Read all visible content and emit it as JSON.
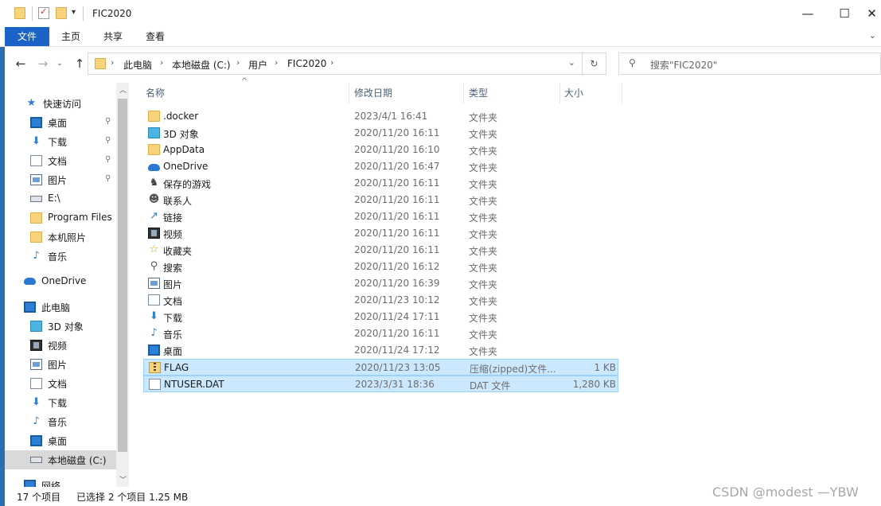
{
  "window": {
    "title": "FIC2020",
    "minimize": "—",
    "maximize": "☐",
    "close": "✕"
  },
  "ribbon": {
    "tabs": [
      "文件",
      "主页",
      "共享",
      "查看"
    ],
    "active_color": "#1c63c7"
  },
  "address": {
    "crumbs": [
      "此电脑",
      "本地磁盘 (C:)",
      "用户",
      "FIC2020"
    ],
    "search_placeholder": "搜索\"FIC2020\""
  },
  "nav": {
    "items": [
      {
        "label": "快速访问",
        "icon": "star-icon",
        "pinned": false
      },
      {
        "label": "桌面",
        "icon": "desktop-icon",
        "pinned": true
      },
      {
        "label": "下载",
        "icon": "download-icon",
        "pinned": true
      },
      {
        "label": "文档",
        "icon": "document-icon",
        "pinned": true
      },
      {
        "label": "图片",
        "icon": "picture-icon",
        "pinned": true
      },
      {
        "label": "E:\\",
        "icon": "drive-icon",
        "pinned": false
      },
      {
        "label": "Program Files",
        "icon": "folder-icon",
        "pinned": false
      },
      {
        "label": "本机照片",
        "icon": "folder-icon",
        "pinned": false
      },
      {
        "label": "音乐",
        "icon": "music-icon",
        "pinned": false
      },
      {
        "label": "OneDrive",
        "icon": "onedrive-icon",
        "pinned": false
      },
      {
        "label": "此电脑",
        "icon": "computer-icon",
        "pinned": false
      },
      {
        "label": "3D 对象",
        "icon": "3d-objects-icon",
        "pinned": false
      },
      {
        "label": "视频",
        "icon": "video-icon",
        "pinned": false
      },
      {
        "label": "图片",
        "icon": "picture-icon",
        "pinned": false
      },
      {
        "label": "文档",
        "icon": "document-icon",
        "pinned": false
      },
      {
        "label": "下载",
        "icon": "download-icon",
        "pinned": false
      },
      {
        "label": "音乐",
        "icon": "music-icon",
        "pinned": false
      },
      {
        "label": "桌面",
        "icon": "desktop-icon",
        "pinned": false
      },
      {
        "label": "本地磁盘 (C:)",
        "icon": "drive-icon",
        "pinned": false
      },
      {
        "label": "网络",
        "icon": "network-icon",
        "pinned": false
      }
    ]
  },
  "columns": {
    "name": "名称",
    "date": "修改日期",
    "type": "类型",
    "size": "大小"
  },
  "files": [
    {
      "name": ".docker",
      "date": "2023/4/1 16:41",
      "type": "文件夹",
      "size": "",
      "icon": "folder-icon",
      "selected": false
    },
    {
      "name": "3D 对象",
      "date": "2020/11/20 16:11",
      "type": "文件夹",
      "size": "",
      "icon": "3d-objects-icon",
      "selected": false
    },
    {
      "name": "AppData",
      "date": "2020/11/20 16:10",
      "type": "文件夹",
      "size": "",
      "icon": "folder-icon",
      "selected": false
    },
    {
      "name": "OneDrive",
      "date": "2020/11/20 16:47",
      "type": "文件夹",
      "size": "",
      "icon": "onedrive-icon",
      "selected": false
    },
    {
      "name": "保存的游戏",
      "date": "2020/11/20 16:11",
      "type": "文件夹",
      "size": "",
      "icon": "saved-games-icon",
      "selected": false
    },
    {
      "name": "联系人",
      "date": "2020/11/20 16:11",
      "type": "文件夹",
      "size": "",
      "icon": "contacts-icon",
      "selected": false
    },
    {
      "name": "链接",
      "date": "2020/11/20 16:11",
      "type": "文件夹",
      "size": "",
      "icon": "links-icon",
      "selected": false
    },
    {
      "name": "视频",
      "date": "2020/11/20 16:11",
      "type": "文件夹",
      "size": "",
      "icon": "video-icon",
      "selected": false
    },
    {
      "name": "收藏夹",
      "date": "2020/11/20 16:11",
      "type": "文件夹",
      "size": "",
      "icon": "favorites-icon",
      "selected": false
    },
    {
      "name": "搜索",
      "date": "2020/11/20 16:12",
      "type": "文件夹",
      "size": "",
      "icon": "search-icon",
      "selected": false
    },
    {
      "name": "图片",
      "date": "2020/11/20 16:39",
      "type": "文件夹",
      "size": "",
      "icon": "picture-icon",
      "selected": false
    },
    {
      "name": "文档",
      "date": "2020/11/23 10:12",
      "type": "文件夹",
      "size": "",
      "icon": "document-icon",
      "selected": false
    },
    {
      "name": "下载",
      "date": "2020/11/24 17:11",
      "type": "文件夹",
      "size": "",
      "icon": "download-icon",
      "selected": false
    },
    {
      "name": "音乐",
      "date": "2020/11/20 16:11",
      "type": "文件夹",
      "size": "",
      "icon": "music-icon",
      "selected": false
    },
    {
      "name": "桌面",
      "date": "2020/11/24 17:12",
      "type": "文件夹",
      "size": "",
      "icon": "desktop-icon",
      "selected": false
    },
    {
      "name": "FLAG",
      "date": "2020/11/23 13:05",
      "type": "压缩(zipped)文件...",
      "size": "1 KB",
      "icon": "zip-file-icon",
      "selected": true
    },
    {
      "name": "NTUSER.DAT",
      "date": "2023/3/31 18:36",
      "type": "DAT 文件",
      "size": "1,280 KB",
      "icon": "file-icon",
      "selected": true
    }
  ],
  "status": {
    "count": "17 个项目",
    "selected": "已选择 2 个项目  1.25 MB"
  },
  "watermark": "CSDN @modest —YBW"
}
